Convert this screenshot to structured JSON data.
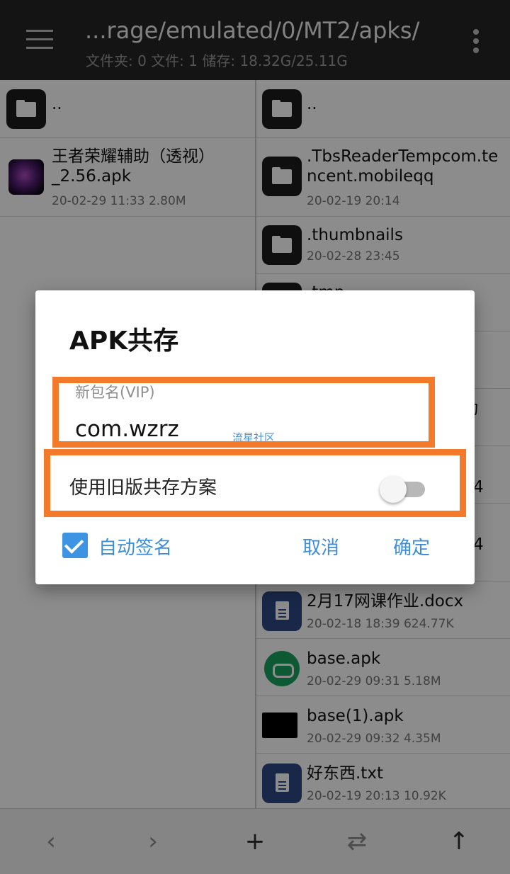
{
  "appbar": {
    "path": "...rage/emulated/0/MT2/apks/",
    "stats": "文件夹: 0  文件: 1  储存: 18.32G/25.11G"
  },
  "left_pane": {
    "items": [
      {
        "name": "..",
        "meta": "",
        "icon": "folder-icon"
      },
      {
        "name": "王者荣耀辅助（透视）_2.56.apk",
        "meta": "20-02-29 11:33  2.80M",
        "icon": "apk-app-icon"
      }
    ]
  },
  "right_pane": {
    "items": [
      {
        "name": "..",
        "meta": "",
        "icon": "folder-icon"
      },
      {
        "name": ".TbsReaderTempcom.tencent.mobileqq",
        "meta": "20-02-19 20:14",
        "icon": "folder-icon"
      },
      {
        "name": ".thumbnails",
        "meta": "20-02-28 23:45",
        "icon": "folder-icon"
      },
      {
        "name": ".tmp",
        "meta": "",
        "icon": "folder-icon"
      },
      {
        "name": "动",
        "meta": "",
        "icon": ""
      },
      {
        "name": "4",
        "meta": "",
        "icon": ""
      },
      {
        "name": "4",
        "meta": "",
        "icon": ""
      },
      {
        "name": "2月17网课作业.docx",
        "meta": "20-02-18 18:39  624.77K",
        "icon": "document-icon"
      },
      {
        "name": "base.apk",
        "meta": "20-02-29 09:31  5.18M",
        "icon": "game-controller-icon"
      },
      {
        "name": "base(1).apk",
        "meta": "20-02-29 09:32  4.35M",
        "icon": "black-apk-icon"
      },
      {
        "name": "好东西.txt",
        "meta": "20-02-19 20:13  10.92K",
        "icon": "document-icon"
      }
    ]
  },
  "bottombar": {
    "back": "‹",
    "forward": "›",
    "add": "+",
    "swap": "⇄",
    "up": "↑"
  },
  "dialog": {
    "title": "APK共存",
    "field_label": "新包名(VIP)",
    "field_value": "com.wzrz",
    "watermark": "流星社区",
    "toggle_label": "使用旧版共存方案",
    "toggle_on": false,
    "checkbox_label": "自动签名",
    "checkbox_checked": true,
    "cancel": "取消",
    "confirm": "确定"
  },
  "colors": {
    "accent": "#3c8ed8",
    "highlight": "#f37a2a",
    "appbar": "#262626"
  }
}
